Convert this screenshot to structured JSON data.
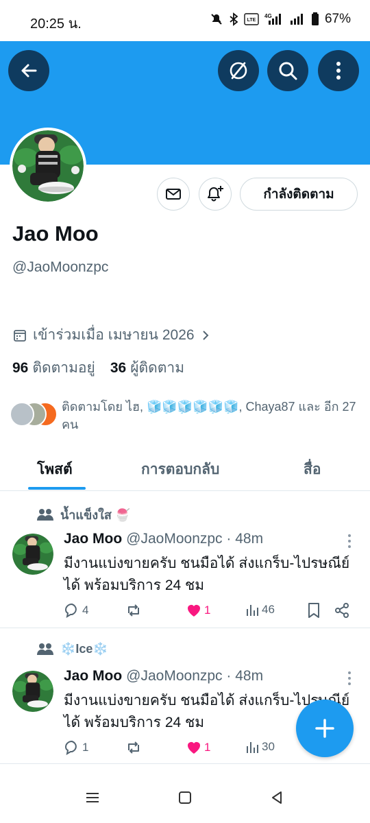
{
  "status_bar": {
    "time": "20:25 น.",
    "battery": "67%",
    "icons": [
      "mute-icon",
      "bluetooth-icon",
      "volte-icon",
      "4g-signal-icon",
      "signal-icon",
      "battery-icon"
    ]
  },
  "header": {
    "banner_color": "#1d9bf0",
    "buttons": [
      "back-arrow-icon",
      "no-translate-icon",
      "search-icon",
      "more-vertical-icon"
    ]
  },
  "profile": {
    "name": "Jao Moo",
    "handle": "@JaoMoonzpc",
    "joined": "เข้าร่วมเมื่อ เมษายน 2026",
    "following_count": "96",
    "following_label": "ติดตามอยู่",
    "followers_count": "36",
    "followers_label": "ผู้ติดตาม",
    "followed_by": "ติดตามโดย ไฮ, 🧊🧊🧊🧊🧊🧊, Chaya87 และ อีก 27 คน",
    "follow_button": "กำลังติดตาม"
  },
  "tabs": [
    {
      "label": "โพสต์",
      "active": true
    },
    {
      "label": "การตอบกลับ",
      "active": false
    },
    {
      "label": "สื่อ",
      "active": false
    }
  ],
  "posts": [
    {
      "community": "น้ำแข็งใส 🍧",
      "author": "Jao Moo",
      "handle": "@JaoMoonzpc",
      "time": "· 48m",
      "text": "มีงานแบ่งขายครับ ชนมือได้ ส่งแกร็บ-ไปรษณีย์ได้ พร้อมบริการ 24 ชม",
      "replies": "4",
      "likes": "1",
      "views": "46"
    },
    {
      "community": "❄️Ice❄️",
      "author": "Jao Moo",
      "handle": "@JaoMoonzpc",
      "time": "· 48m",
      "text": "มีงานแบ่งขายครับ ชนมือได้ ส่งแกร็บ-ไปรษณีย์ได้ พร้อมบริการ 24 ชม",
      "replies": "1",
      "likes": "1",
      "views": "30"
    }
  ],
  "colors": {
    "accent": "#1d9bf0",
    "like": "#f91880",
    "muted": "#536471",
    "header_button": "#0f3b5f"
  }
}
